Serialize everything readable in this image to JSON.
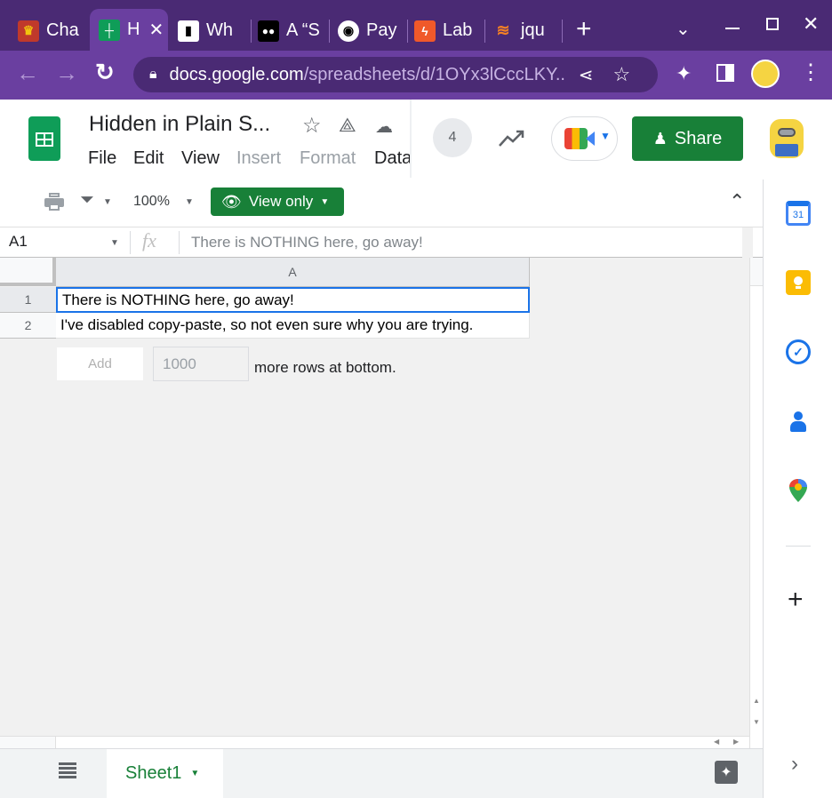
{
  "browser": {
    "tabs": [
      {
        "label": "Cha",
        "icon": "game-icon"
      },
      {
        "label": "H",
        "icon": "sheets-icon",
        "active": true
      },
      {
        "label": "Wh",
        "icon": "book-icon"
      },
      {
        "label": "A “S",
        "icon": "medium-icon"
      },
      {
        "label": "Pay",
        "icon": "github-icon"
      },
      {
        "label": "Lab",
        "icon": "bolt-icon"
      },
      {
        "label": "jqu",
        "icon": "stackoverflow-icon"
      }
    ],
    "url_host": "docs.google.com",
    "url_path": "/spreadsheets/d/1OYx3lCccLKY..."
  },
  "doc": {
    "title": "Hidden in Plain S...",
    "menus": [
      {
        "label": "File",
        "enabled": true
      },
      {
        "label": "Edit",
        "enabled": true
      },
      {
        "label": "View",
        "enabled": true
      },
      {
        "label": "Insert",
        "enabled": false
      },
      {
        "label": "Format",
        "enabled": false
      },
      {
        "label": "Data",
        "enabled": true
      }
    ],
    "viewer_count": "4",
    "share_label": "Share"
  },
  "toolbar": {
    "zoom": "100%",
    "view_only_label": "View only"
  },
  "formula_bar": {
    "cell_ref": "A1",
    "fx": "fx",
    "content": "There is NOTHING here, go away!"
  },
  "sheet": {
    "column_header": "A",
    "rows": [
      {
        "num": "1",
        "value": "There is NOTHING here, go away!"
      },
      {
        "num": "2",
        "value": "I've disabled copy-paste, so not even sure why you are trying."
      }
    ],
    "add_label": "Add",
    "add_rows_value": "1000",
    "add_rows_suffix": "more rows at bottom."
  },
  "bottom": {
    "sheet_tab": "Sheet1"
  },
  "side_panel": {
    "calendar_day": "31"
  },
  "colors": {
    "tabstrip": "#4a2a74",
    "toolbar_purple": "#6a3fa0",
    "green": "#188038",
    "selection": "#1a73e8"
  }
}
